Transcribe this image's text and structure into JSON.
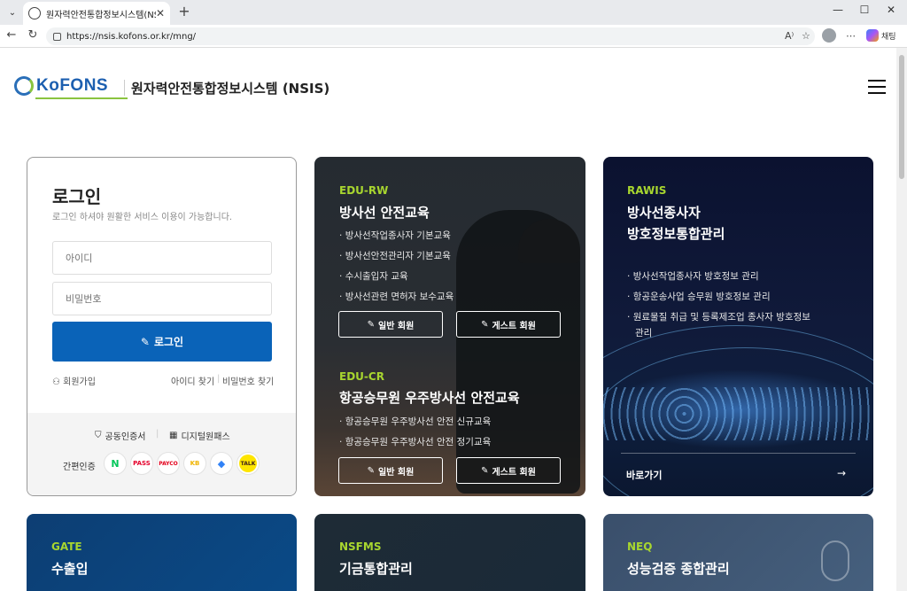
{
  "browser": {
    "tab_title": "원자력안전통합정보시스템(NSIS)",
    "url": "https://nsis.kofons.or.kr/mng/",
    "copilot_label": "채팅"
  },
  "header": {
    "logo_text": "KoFONS",
    "site_title": "원자력안전통합정보시스템 (NSIS)"
  },
  "login": {
    "title": "로그인",
    "subtitle": "로그인 하셔야 원활한 서비스 이용이 가능합니다.",
    "id_placeholder": "아이디",
    "pw_placeholder": "비밀번호",
    "login_button": "로그인",
    "signup": "회원가입",
    "find_id": "아이디 찾기",
    "find_pw": "비밀번호 찾기",
    "cert": "공동인증서",
    "digital_pass": "디지털원패스",
    "easy_auth": "간편인증",
    "easy_icons": [
      {
        "name": "naver",
        "label": "N",
        "color": "#03c75a"
      },
      {
        "name": "pass",
        "label": "PASS",
        "color": "#e4002b"
      },
      {
        "name": "payco",
        "label": "PAYCO",
        "color": "#e3001b"
      },
      {
        "name": "kb",
        "label": "KB",
        "color": "#f0b400"
      },
      {
        "name": "toss",
        "label": "◆",
        "color": "#3182f6"
      },
      {
        "name": "kakao",
        "label": "TALK",
        "color": "#3c1e1e"
      }
    ]
  },
  "edu_rw": {
    "code": "EDU-RW",
    "title": "방사선 안전교육",
    "bullets": [
      "방사선작업종사자 기본교육",
      "방사선안전관리자 기본교육",
      "수시출입자 교육",
      "방사선관련 면허자 보수교육"
    ],
    "btn_general": "일반 회원",
    "btn_guest": "게스트 회원"
  },
  "edu_cr": {
    "code": "EDU-CR",
    "title": "항공승무원 우주방사선 안전교육",
    "bullets": [
      "항공승무원 우주방사선 안전 신규교육",
      "항공승무원 우주방사선 안전 정기교육"
    ],
    "btn_general": "일반 회원",
    "btn_guest": "게스트 회원"
  },
  "rawis": {
    "code": "RAWIS",
    "title_line1": "방사선종사자",
    "title_line2": "방호정보통합관리",
    "bullets": [
      "방사선작업종사자 방호정보 관리",
      "항공운송사업 승무원 방호정보 관리",
      "원료물질 취급 및 등록제조업 종사자 방호정보",
      "관리"
    ],
    "go": "바로가기"
  },
  "bottom": {
    "gate_code": "GATE",
    "gate_title": "수출입",
    "nsfms_code": "NSFMS",
    "nsfms_title": "기금통합관리",
    "neq_code": "NEQ",
    "neq_title": "성능검증 종합관리"
  }
}
